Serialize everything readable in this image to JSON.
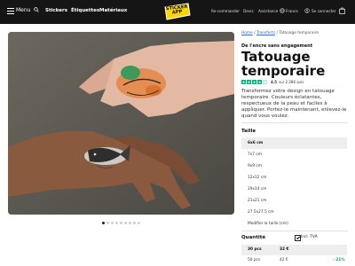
{
  "nav": {
    "menu_label": "Menu",
    "links": [
      "Stickers",
      "Étiquettes",
      "Matériaux"
    ],
    "logo_lines": [
      "STICKER",
      "APP"
    ],
    "right_links": [
      "Re-commander",
      "Devis",
      "Assistance",
      "France",
      "Se connecter"
    ]
  },
  "breadcrumb": {
    "home": "Home",
    "category": "Transferts",
    "current": "Tatouage temporaire",
    "sep": "/"
  },
  "product": {
    "eyebrow": "De l'encre sans engagement",
    "title_line1": "Tatouage",
    "title_line2": "temporaire",
    "rating_value": "4.5",
    "rating_text": "sur 2.286 avis",
    "description": "Transformez votre design en tatouage temporaire. Couleurs éclatantes, respectueux de la peau et faciles à appliquer. Portez-le maintenant, enlevez-le quand vous voulez."
  },
  "size": {
    "label": "Taille",
    "options": [
      "6x6 cm",
      "7x7 cm",
      "9x9 cm",
      "12x12 cm",
      "19x14 cm",
      "21x21 cm",
      "27.5x27.5 cm",
      "Modifier la taille (cm)"
    ],
    "selected_index": 0
  },
  "quantity": {
    "label": "Quantité",
    "vat_label": "Incl. TVA",
    "rows": [
      {
        "qty": "30 pcs",
        "price": "32 €",
        "discount": ""
      },
      {
        "qty": "50 pcs",
        "price": "42 €",
        "discount": "- 21%"
      }
    ],
    "selected_index": 0
  },
  "carousel": {
    "count": 9,
    "active": 0
  },
  "colors": {
    "topbar": "#151515",
    "logo_yellow": "#ffd400",
    "trustpilot_green": "#00b67a",
    "link_blue": "#2b6ad3"
  }
}
